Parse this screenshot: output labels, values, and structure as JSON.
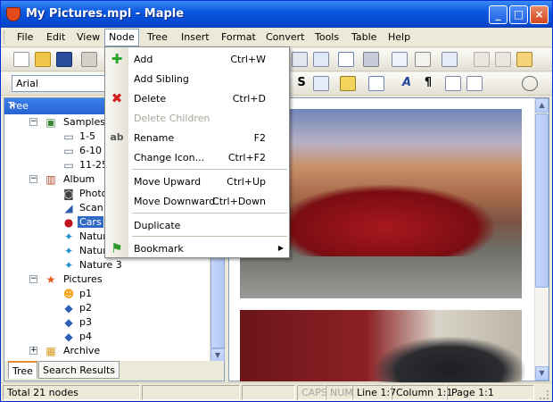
{
  "window": {
    "title": "My Pictures.mpl - Maple",
    "min": "_",
    "max": "□",
    "close": "×"
  },
  "menubar": [
    "File",
    "Edit",
    "View",
    "Node",
    "Tree",
    "Insert",
    "Format",
    "Convert",
    "Tools",
    "Table",
    "Help"
  ],
  "menubar_active": "Node",
  "font_combo": {
    "value": "Arial"
  },
  "left_pane": {
    "header": "Tree",
    "close": "×"
  },
  "tree": [
    {
      "label": "Samples",
      "icon": "photo-folder-icon",
      "expander": "−"
    },
    {
      "label": "1-5",
      "icon": "monitor-icon"
    },
    {
      "label": "6-10",
      "icon": "monitor-icon"
    },
    {
      "label": "11-25",
      "icon": "monitor-icon"
    },
    {
      "label": "Album",
      "icon": "books-icon",
      "expander": "−"
    },
    {
      "label": "Photo",
      "icon": "camera-icon"
    },
    {
      "label": "Scan",
      "icon": "scanner-icon"
    },
    {
      "label": "Cars",
      "icon": "car-icon",
      "selected": true
    },
    {
      "label": "Nature",
      "icon": "butterfly-icon"
    },
    {
      "label": "Nature",
      "icon": "butterfly-icon"
    },
    {
      "label": "Nature 3",
      "icon": "butterfly-icon"
    },
    {
      "label": "Pictures",
      "icon": "star-icon",
      "expander": "−"
    },
    {
      "label": "p1",
      "icon": "smiley-icon"
    },
    {
      "label": "p2",
      "icon": "diamond-icon"
    },
    {
      "label": "p3",
      "icon": "diamond-icon"
    },
    {
      "label": "p4",
      "icon": "diamond-icon"
    },
    {
      "label": "Archive",
      "icon": "box-icon",
      "expander": "+"
    }
  ],
  "tabs": [
    "Tree",
    "Search Results"
  ],
  "node_menu": [
    {
      "label": "Add",
      "shortcut": "Ctrl+W",
      "icon": "plus-icon",
      "enabled": true
    },
    {
      "label": "Add Sibling",
      "shortcut": "",
      "enabled": true
    },
    {
      "label": "Delete",
      "shortcut": "Ctrl+D",
      "icon": "delete-x-icon",
      "enabled": true
    },
    {
      "label": "Delete Children",
      "shortcut": "",
      "enabled": false
    },
    {
      "label": "Rename",
      "shortcut": "F2",
      "icon": "rename-icon",
      "enabled": true
    },
    {
      "label": "Change Icon...",
      "shortcut": "Ctrl+F2",
      "enabled": true
    },
    {
      "label": "Move Upward",
      "shortcut": "Ctrl+Up",
      "enabled": true
    },
    {
      "label": "Move Downward",
      "shortcut": "Ctrl+Down",
      "enabled": true
    },
    {
      "label": "Duplicate",
      "shortcut": "",
      "enabled": true
    },
    {
      "label": "Bookmark",
      "shortcut": "",
      "icon": "bookmark-icon",
      "enabled": true,
      "submenu": true
    }
  ],
  "status": {
    "nodes": "Total 21 nodes",
    "caps": "CAPS",
    "num": "NUM",
    "line": "Line 1:7",
    "column": "Column 1:1",
    "page": "Page 1:1"
  },
  "colors": {
    "titlebar": "#0a58e0",
    "selection": "#316ac5",
    "pane_header": "#2a62d4"
  }
}
